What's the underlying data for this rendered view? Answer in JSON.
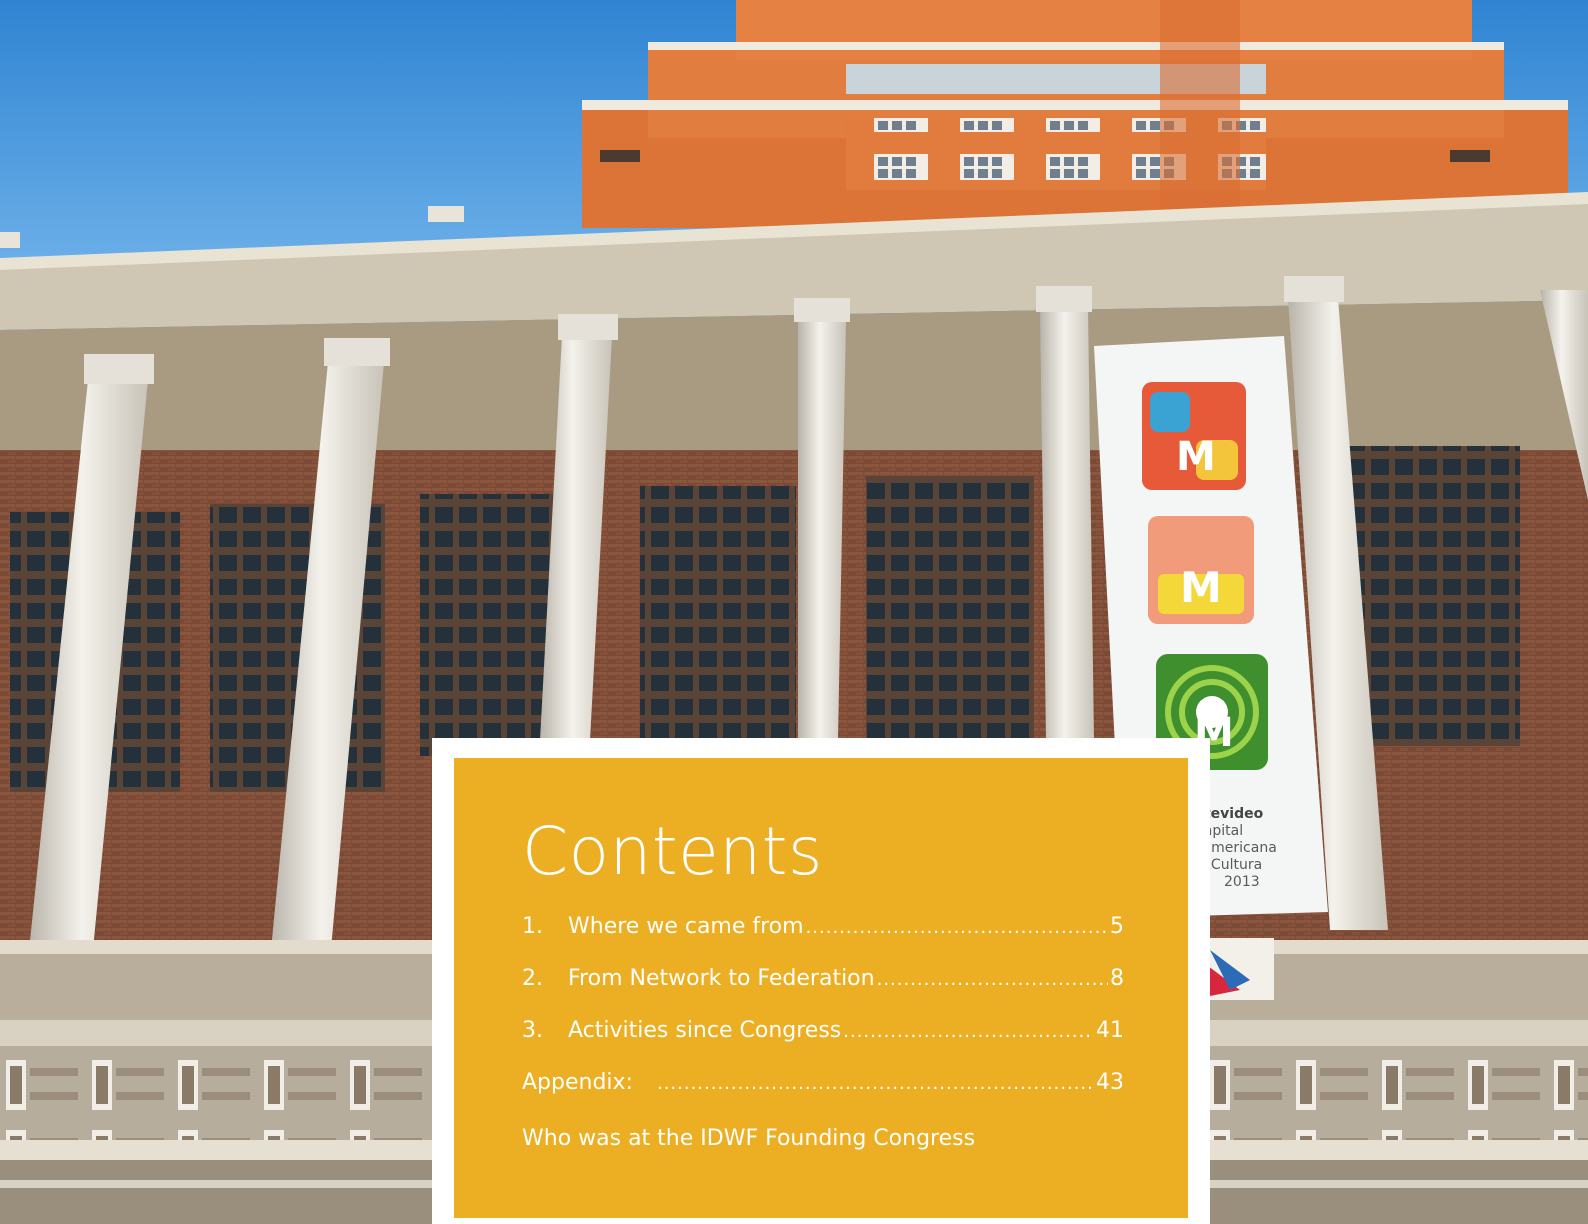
{
  "photo": {
    "subject": "",
    "banner_caption_lines": [
      "ntevideo",
      "Capital",
      "oamericana",
      "la Cultura",
      "2013"
    ]
  },
  "colors": {
    "sky": "#3a8fd6",
    "tower": "#e07a3c",
    "brick": "#7a4a36",
    "column": "#e9e6df",
    "contents_box": "#ecae22",
    "contents_text": "#ffffff"
  },
  "contents": {
    "title": "Contents",
    "items": [
      {
        "number": "1.",
        "label": "Where we came from",
        "page": "5"
      },
      {
        "number": "2.",
        "label": "From Network to Federation",
        "page": "8"
      },
      {
        "number": "3.",
        "label": "Activities since Congress",
        "page": "41"
      }
    ],
    "appendix": {
      "label": "Appendix:",
      "page": "43",
      "subtitle": "Who was at the IDWF Founding Congress"
    }
  }
}
